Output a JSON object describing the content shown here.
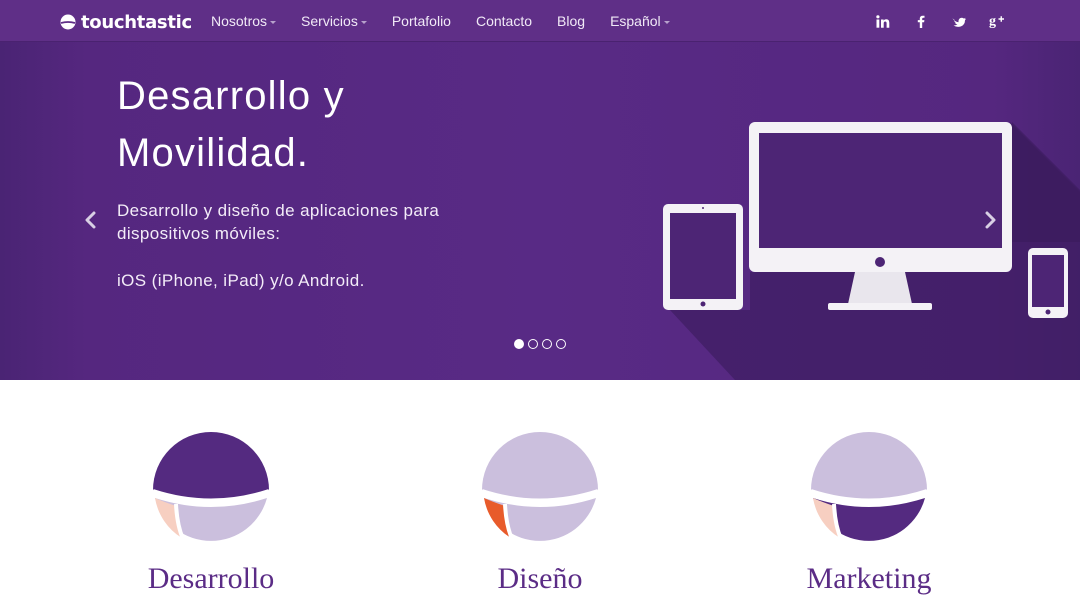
{
  "brand": {
    "name": "touchtastic",
    "icon": "logo-mark-icon"
  },
  "nav": {
    "items": [
      {
        "label": "Nosotros",
        "dropdown": true
      },
      {
        "label": "Servicios",
        "dropdown": true
      },
      {
        "label": "Portafolio",
        "dropdown": false
      },
      {
        "label": "Contacto",
        "dropdown": false
      },
      {
        "label": "Blog",
        "dropdown": false
      },
      {
        "label": "Español",
        "dropdown": true
      }
    ]
  },
  "social": [
    {
      "name": "linkedin",
      "icon": "linkedin-icon"
    },
    {
      "name": "facebook",
      "icon": "facebook-icon"
    },
    {
      "name": "twitter",
      "icon": "twitter-icon"
    },
    {
      "name": "google-plus",
      "icon": "google-plus-icon"
    }
  ],
  "hero": {
    "title_line1": "Desarrollo y",
    "title_line2": "Movilidad.",
    "subtitle": "Desarrollo y diseño de aplicaciones para dispositivos móviles:",
    "platforms": "iOS (iPhone, iPad) y/o Android.",
    "slides_total": 4,
    "active_slide": 1
  },
  "features": [
    {
      "label": "Desarrollo",
      "icon": "development-circle-icon"
    },
    {
      "label": "Diseño",
      "icon": "design-circle-icon"
    },
    {
      "label": "Marketing",
      "icon": "marketing-circle-icon"
    }
  ],
  "colors": {
    "brand_purple": "#5f2f87",
    "hero_purple": "#582a85",
    "light_lilac": "#cbbfdd",
    "peach": "#f7cfc1",
    "orange": "#e85b2b",
    "text_purple": "#5b2c86"
  }
}
